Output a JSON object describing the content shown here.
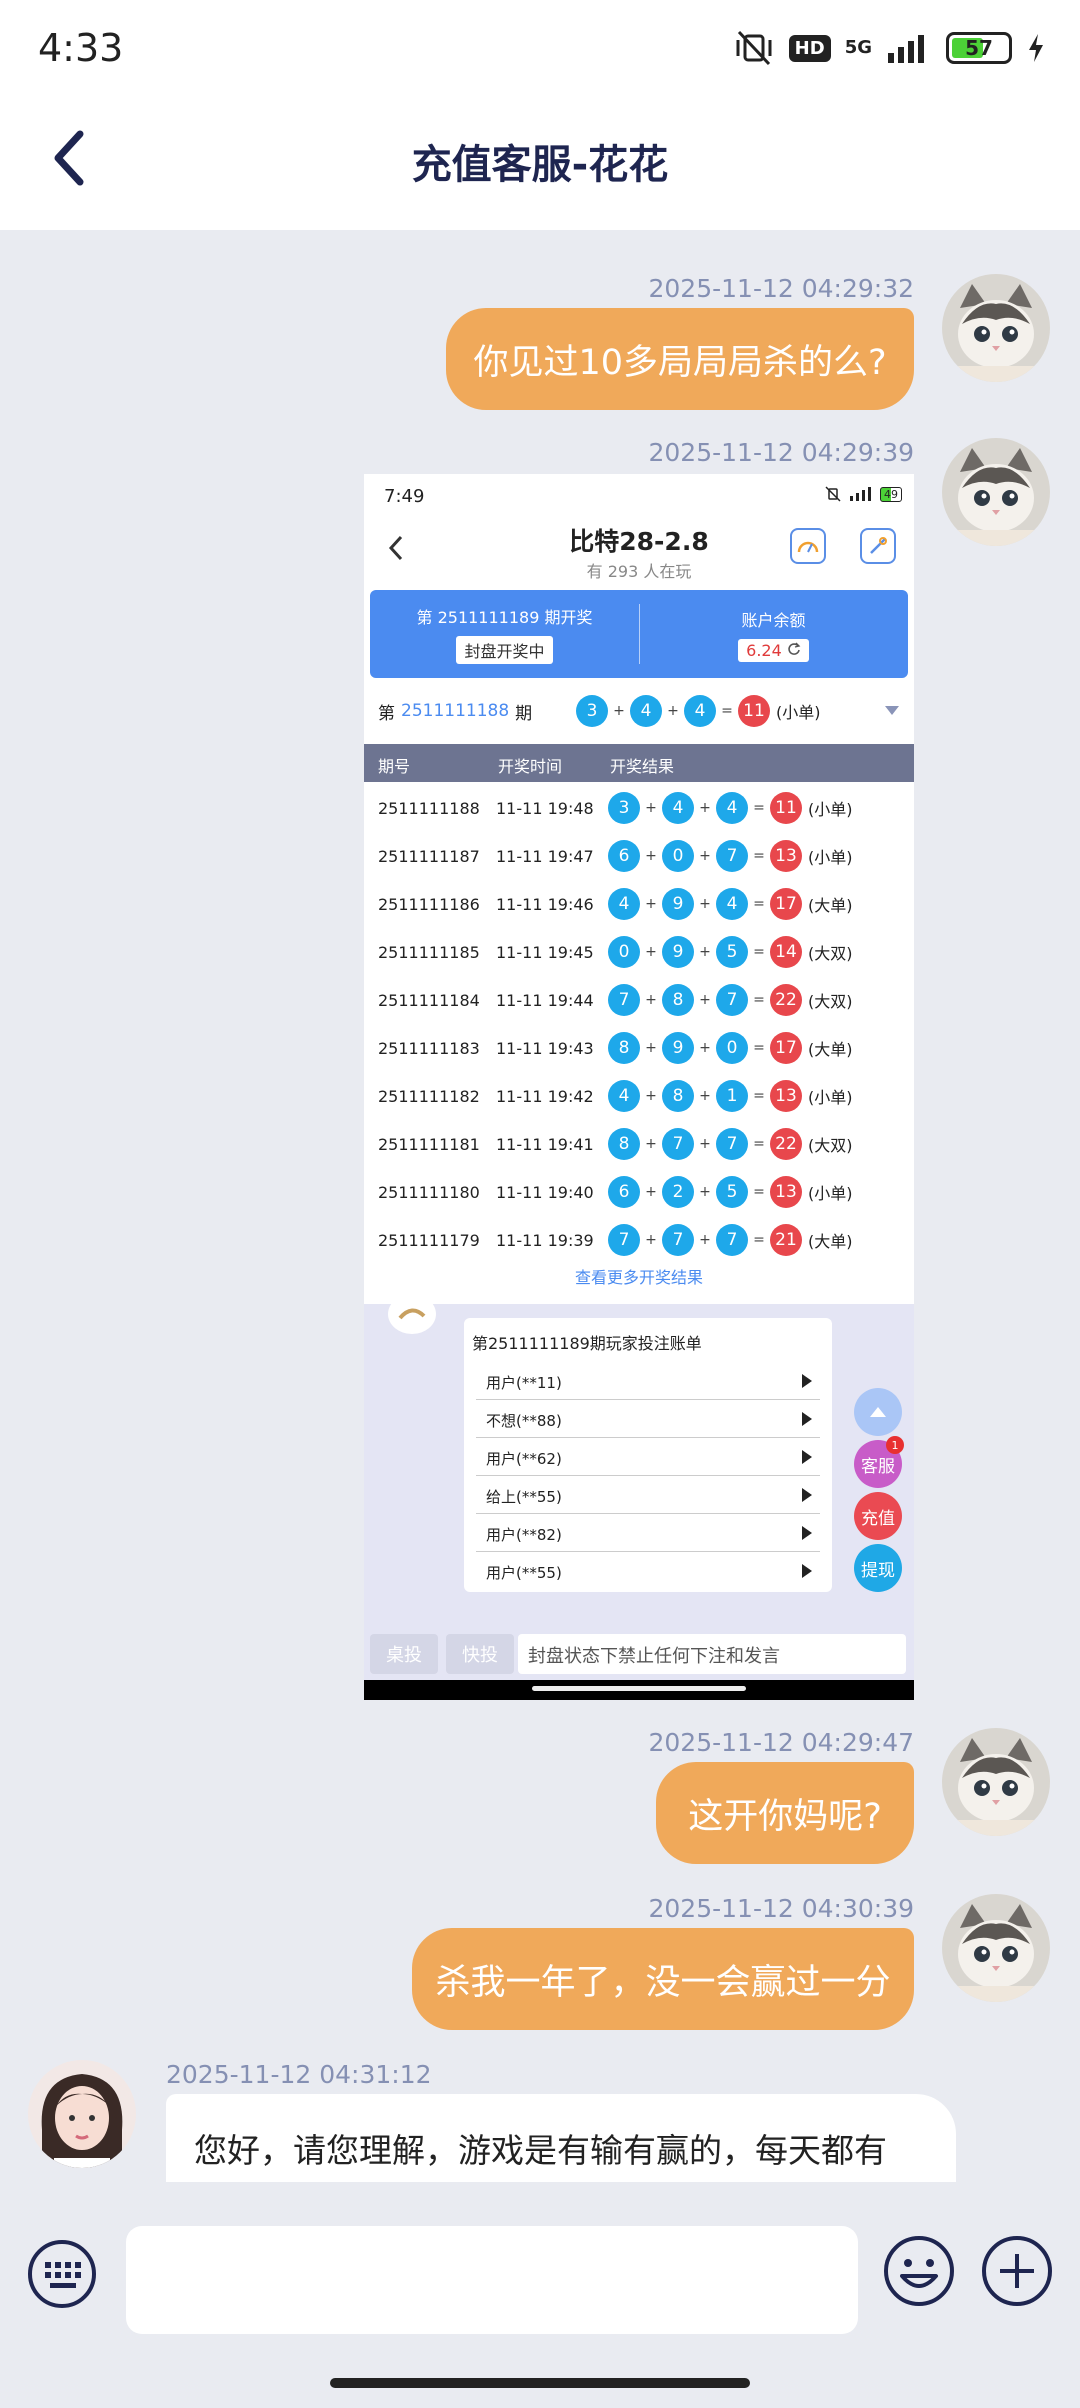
{
  "status_bar": {
    "time": "4:33",
    "hd": "HD",
    "network": "5G",
    "battery": "57"
  },
  "header": {
    "title": "充值客服-花花"
  },
  "messages": [
    {
      "timestamp": "2025-11-12 04:29:32",
      "text": "你见过10多局局局杀的么?"
    },
    {
      "timestamp": "2025-11-12 04:29:39"
    },
    {
      "timestamp": "2025-11-12 04:29:47",
      "text": "这开你妈呢?"
    },
    {
      "timestamp": "2025-11-12 04:30:39",
      "text": "杀我一年了，没一会赢过一分"
    },
    {
      "timestamp": "2025-11-12 04:31:12",
      "text": "您好，请您理解，游戏是有输有赢的，每天都有"
    }
  ],
  "screenshot": {
    "time": "7:49",
    "battery": "49",
    "title": "比特28-2.8",
    "subtitle": "有 293 人在玩",
    "issue_label": "第 2511111189 期开奖",
    "status_badge": "封盘开奖中",
    "balance_label": "账户余额",
    "balance_value": "6.24",
    "current": {
      "prefix": "第",
      "issue": "2511111188",
      "suffix": "期",
      "balls": [
        "3",
        "4",
        "4"
      ],
      "sum": "11",
      "result": "(小单)"
    },
    "columns": [
      "期号",
      "开奖时间",
      "开奖结果"
    ],
    "rows": [
      {
        "issue": "2511111188",
        "time": "11-11 19:48",
        "balls": [
          "3",
          "4",
          "4"
        ],
        "sum": "11",
        "result": "(小单)"
      },
      {
        "issue": "2511111187",
        "time": "11-11 19:47",
        "balls": [
          "6",
          "0",
          "7"
        ],
        "sum": "13",
        "result": "(小单)"
      },
      {
        "issue": "2511111186",
        "time": "11-11 19:46",
        "balls": [
          "4",
          "9",
          "4"
        ],
        "sum": "17",
        "result": "(大单)"
      },
      {
        "issue": "2511111185",
        "time": "11-11 19:45",
        "balls": [
          "0",
          "9",
          "5"
        ],
        "sum": "14",
        "result": "(大双)"
      },
      {
        "issue": "2511111184",
        "time": "11-11 19:44",
        "balls": [
          "7",
          "8",
          "7"
        ],
        "sum": "22",
        "result": "(大双)"
      },
      {
        "issue": "2511111183",
        "time": "11-11 19:43",
        "balls": [
          "8",
          "9",
          "0"
        ],
        "sum": "17",
        "result": "(大单)"
      },
      {
        "issue": "2511111182",
        "time": "11-11 19:42",
        "balls": [
          "4",
          "8",
          "1"
        ],
        "sum": "13",
        "result": "(小单)"
      },
      {
        "issue": "2511111181",
        "time": "11-11 19:41",
        "balls": [
          "8",
          "7",
          "7"
        ],
        "sum": "22",
        "result": "(大双)"
      },
      {
        "issue": "2511111180",
        "time": "11-11 19:40",
        "balls": [
          "6",
          "2",
          "5"
        ],
        "sum": "13",
        "result": "(小单)"
      },
      {
        "issue": "2511111179",
        "time": "11-11 19:39",
        "balls": [
          "7",
          "7",
          "7"
        ],
        "sum": "21",
        "result": "(大单)"
      }
    ],
    "more_link": "查看更多开奖结果",
    "bet_title": "第2511111189期玩家投注账单",
    "bets": [
      "用户(**11)",
      "不想(**88)",
      "用户(**62)",
      "给上(**55)",
      "用户(**82)",
      "用户(**55)"
    ],
    "fab": {
      "service": "客服",
      "service_badge": "1",
      "recharge": "充值",
      "withdraw": "提现"
    },
    "tabs": [
      "桌投",
      "快投"
    ],
    "input_placeholder": "封盘状态下禁止任何下注和发言"
  },
  "colors": {
    "accent": "#f0a95a",
    "timestamp": "#8590b3",
    "ball_blue": "#1ea8ea",
    "ball_red": "#e8474c"
  }
}
